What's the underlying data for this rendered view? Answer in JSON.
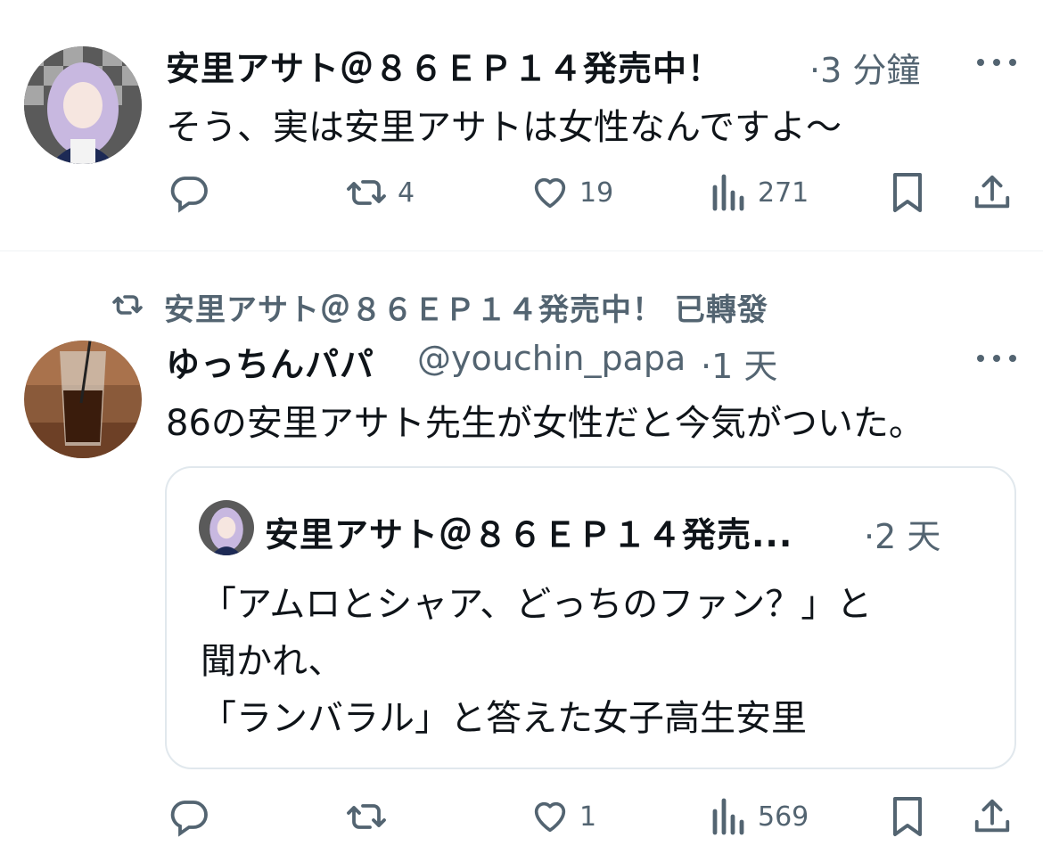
{
  "tweet1": {
    "author_name": "安里アサト＠８６ＥＰ１４発売中！",
    "time": "·3 分鐘",
    "text": "そう、実は安里アサトは女性なんですよ～",
    "actions": {
      "reply_icon": "reply-icon",
      "retweet_icon": "retweet-icon",
      "retweet_count": "4",
      "like_icon": "heart-icon",
      "like_count": "19",
      "views_icon": "views-chart-icon",
      "views_count": "271",
      "bookmark_icon": "bookmark-icon",
      "share_icon": "share-icon"
    }
  },
  "tweet2": {
    "retweeted_by": "安里アサト＠８６ＥＰ１４発売中！ 已轉發",
    "author_name": "ゆっちんパパ",
    "handle": "@youchin_papa",
    "time": "·1 天",
    "text": "86の安里アサト先生が女性だと今気がついた。",
    "quote": {
      "author_name": "安里アサト＠８６ＥＰ１４発売...",
      "time": "·2 天",
      "lines": [
        "「アムロとシャア、どっちのファン？」と",
        "聞かれ、",
        "「ランバラル」と答えた女子高生安里"
      ]
    },
    "actions": {
      "reply_icon": "reply-icon",
      "retweet_icon": "retweet-icon",
      "like_icon": "heart-icon",
      "like_count": "1",
      "views_icon": "views-chart-icon",
      "views_count": "569",
      "bookmark_icon": "bookmark-icon",
      "share_icon": "share-icon"
    }
  },
  "colors": {
    "text_primary": "#0f1419",
    "text_secondary": "#536471",
    "border": "#e1e8ed"
  }
}
